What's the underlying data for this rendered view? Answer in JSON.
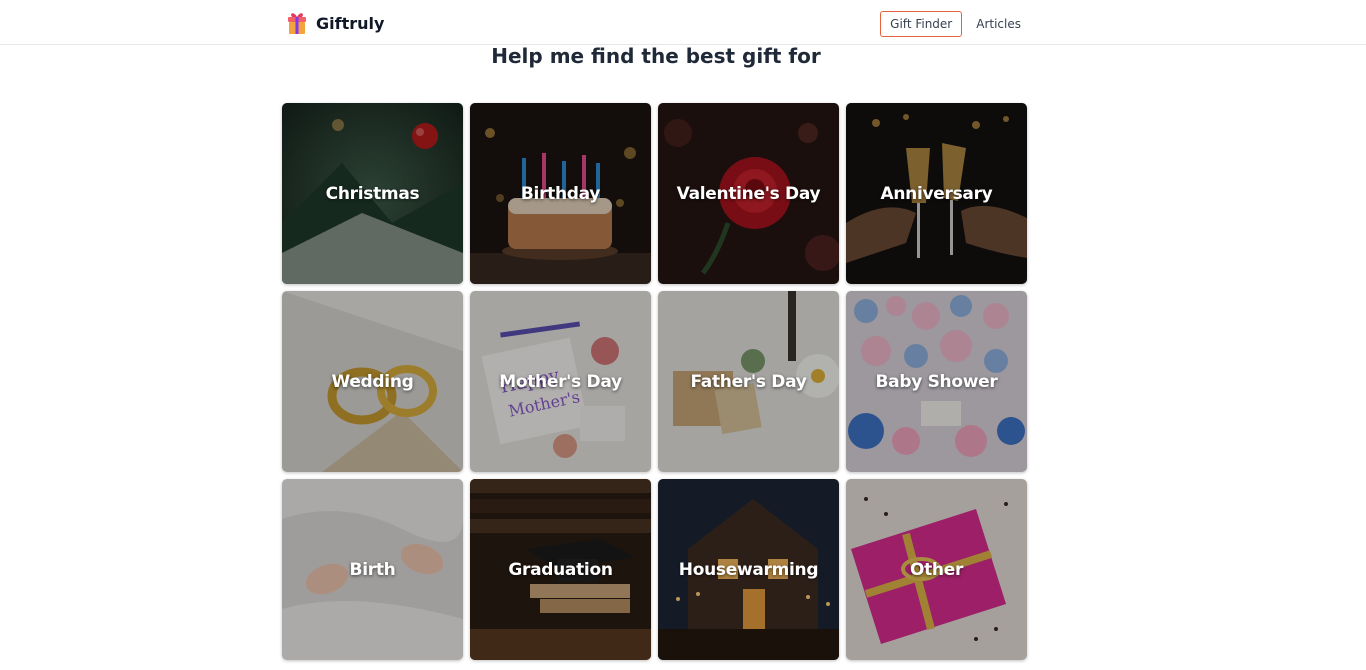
{
  "brand": {
    "name": "Giftruly",
    "icon": "gift-icon"
  },
  "nav": {
    "gift_finder": "Gift Finder",
    "articles": "Articles"
  },
  "headline": "Help me find the best gift for",
  "occasions": [
    {
      "label": "Christmas"
    },
    {
      "label": "Birthday"
    },
    {
      "label": "Valentine's Day"
    },
    {
      "label": "Anniversary"
    },
    {
      "label": "Wedding"
    },
    {
      "label": "Mother's Day"
    },
    {
      "label": "Father's Day"
    },
    {
      "label": "Baby Shower"
    },
    {
      "label": "Birth"
    },
    {
      "label": "Graduation"
    },
    {
      "label": "Housewarming"
    },
    {
      "label": "Other"
    }
  ],
  "colors": {
    "accent": "#e8603c"
  }
}
